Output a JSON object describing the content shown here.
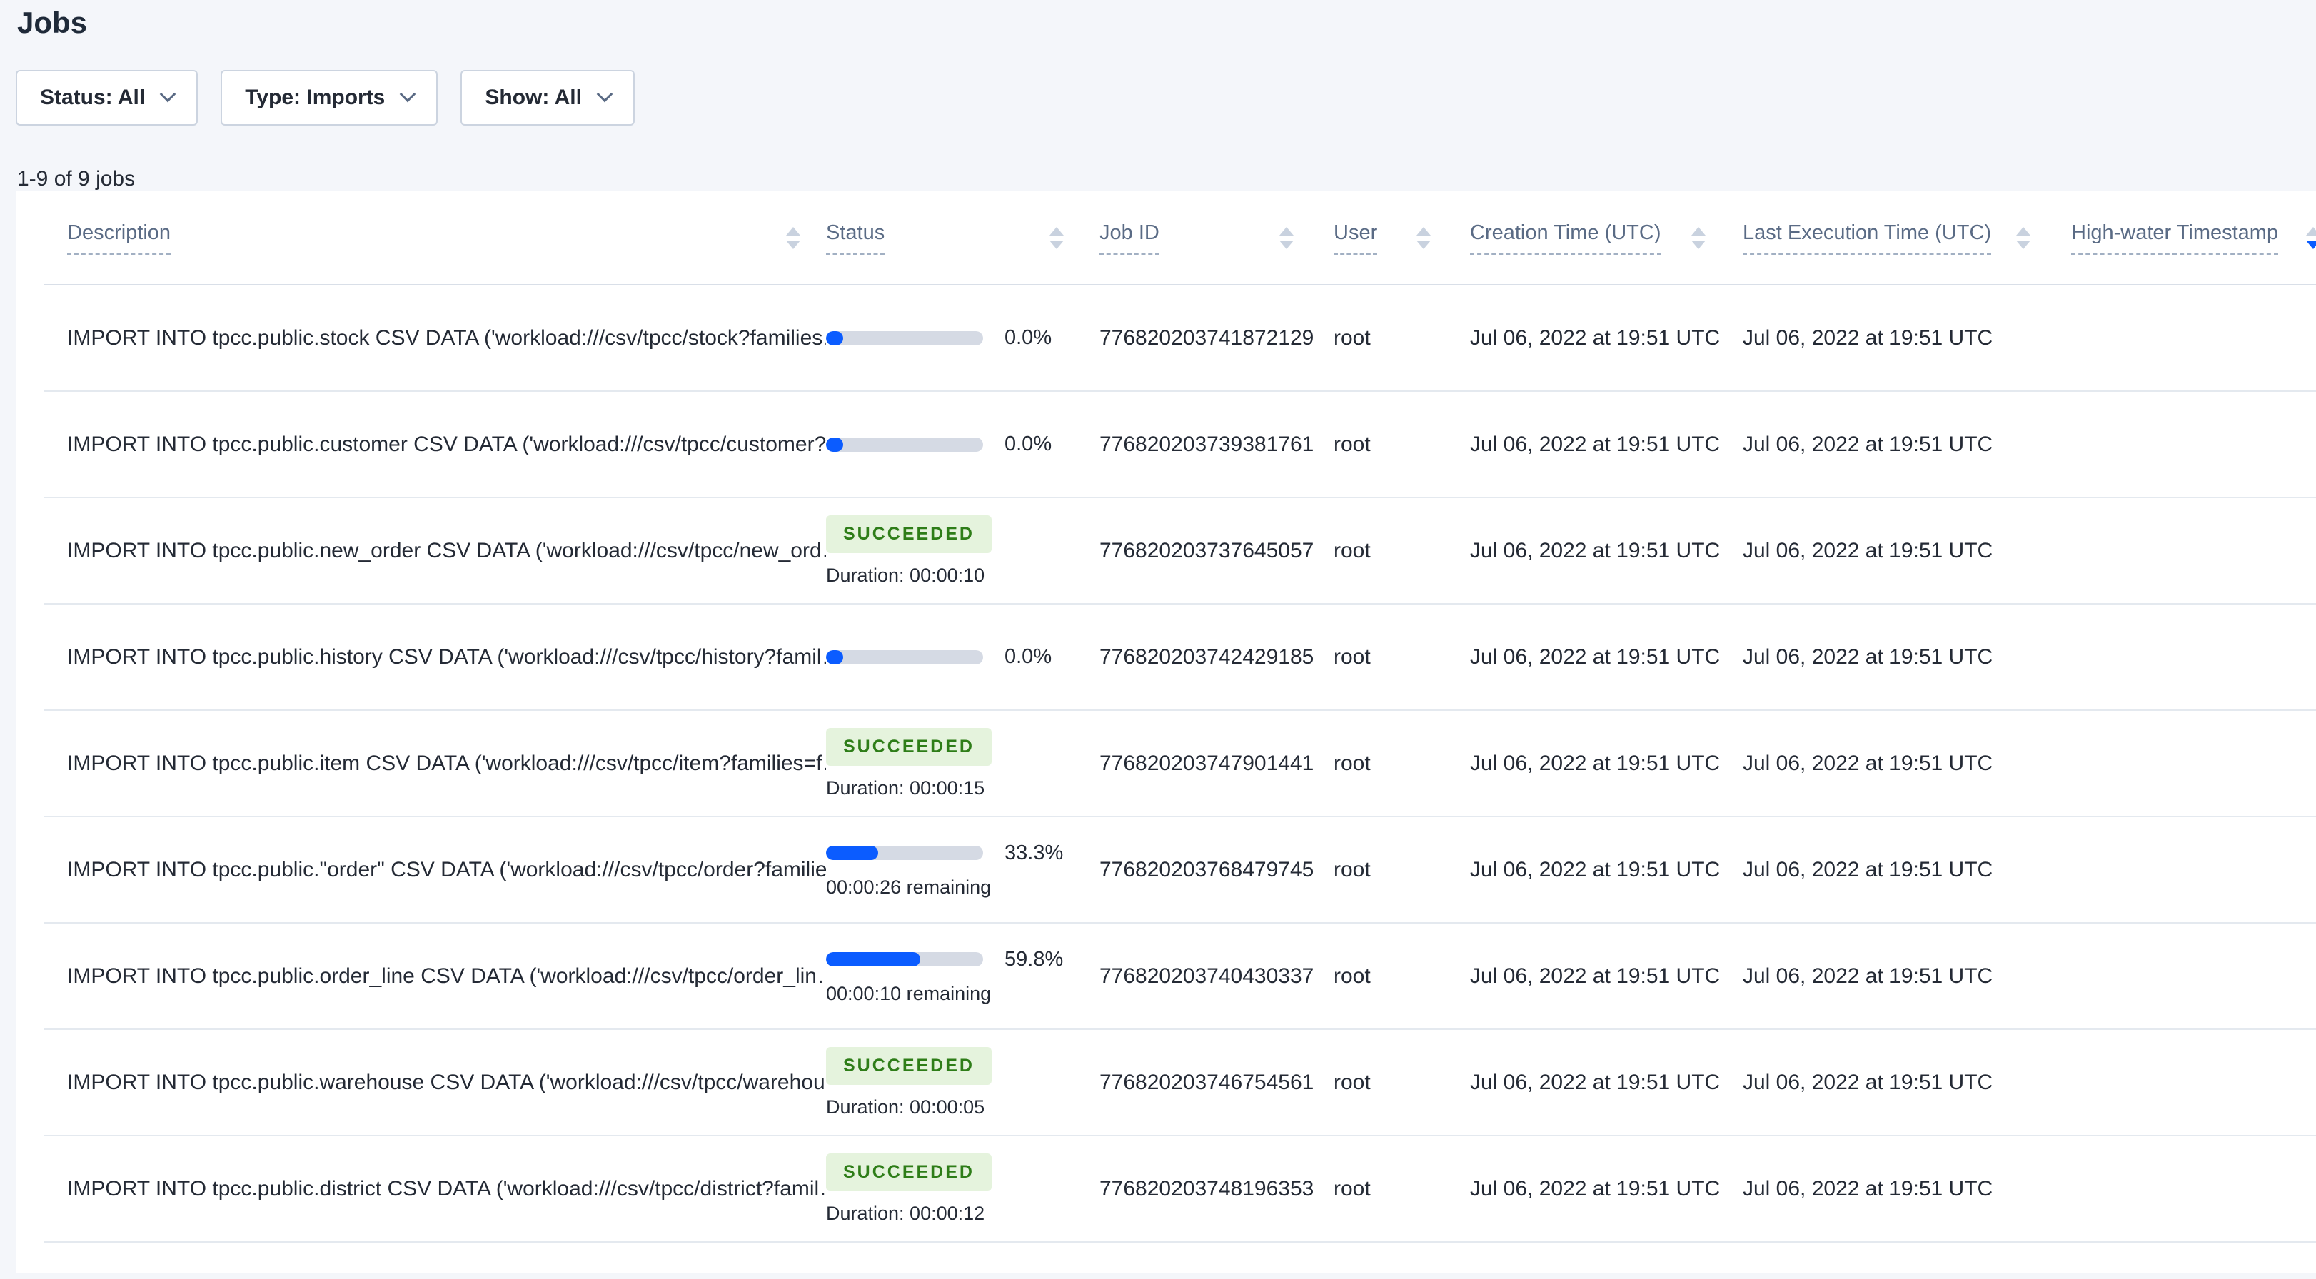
{
  "page": {
    "title": "Jobs",
    "jobs_count": "1-9 of 9 jobs"
  },
  "filters": [
    {
      "label": "Status: All"
    },
    {
      "label": "Type: Imports"
    },
    {
      "label": "Show: All"
    }
  ],
  "colors": {
    "accent_blue": "#0b5cff",
    "progress_track": "#d5dae4",
    "success_text": "#2e7d18",
    "success_bg": "#e5f3dd",
    "page_bg": "#f4f6fa",
    "header_text": "#5a6b85",
    "body_text": "#242a35"
  },
  "table": {
    "columns": [
      {
        "label": "Description",
        "sort": "inactive"
      },
      {
        "label": "Status",
        "sort": "inactive"
      },
      {
        "label": "Job ID",
        "sort": "inactive"
      },
      {
        "label": "User",
        "sort": "inactive"
      },
      {
        "label": "Creation Time (UTC)",
        "sort": "inactive"
      },
      {
        "label": "Last Execution Time (UTC)",
        "sort": "inactive"
      },
      {
        "label": "High-water Timestamp",
        "sort": "desc"
      }
    ],
    "rows": [
      {
        "description": "IMPORT INTO tpcc.public.stock CSV DATA ('workload:///csv/tpcc/stock?families…",
        "status": {
          "kind": "progress",
          "percent": "0.0%",
          "fraction": 0
        },
        "job_id": "776820203741872129",
        "user": "root",
        "creation_time": "Jul 06, 2022 at 19:51 UTC",
        "last_execution_time": "Jul 06, 2022 at 19:51 UTC",
        "high_water": ""
      },
      {
        "description": "IMPORT INTO tpcc.public.customer CSV DATA ('workload:///csv/tpcc/customer?f…",
        "status": {
          "kind": "progress",
          "percent": "0.0%",
          "fraction": 0
        },
        "job_id": "776820203739381761",
        "user": "root",
        "creation_time": "Jul 06, 2022 at 19:51 UTC",
        "last_execution_time": "Jul 06, 2022 at 19:51 UTC",
        "high_water": ""
      },
      {
        "description": "IMPORT INTO tpcc.public.new_order CSV DATA ('workload:///csv/tpcc/new_ord…",
        "status": {
          "kind": "succeeded",
          "label": "SUCCEEDED",
          "duration": "Duration: 00:00:10"
        },
        "job_id": "776820203737645057",
        "user": "root",
        "creation_time": "Jul 06, 2022 at 19:51 UTC",
        "last_execution_time": "Jul 06, 2022 at 19:51 UTC",
        "high_water": ""
      },
      {
        "description": "IMPORT INTO tpcc.public.history CSV DATA ('workload:///csv/tpcc/history?famil…",
        "status": {
          "kind": "progress",
          "percent": "0.0%",
          "fraction": 0
        },
        "job_id": "776820203742429185",
        "user": "root",
        "creation_time": "Jul 06, 2022 at 19:51 UTC",
        "last_execution_time": "Jul 06, 2022 at 19:51 UTC",
        "high_water": ""
      },
      {
        "description": "IMPORT INTO tpcc.public.item CSV DATA ('workload:///csv/tpcc/item?families=f…",
        "status": {
          "kind": "succeeded",
          "label": "SUCCEEDED",
          "duration": "Duration: 00:00:15"
        },
        "job_id": "776820203747901441",
        "user": "root",
        "creation_time": "Jul 06, 2022 at 19:51 UTC",
        "last_execution_time": "Jul 06, 2022 at 19:51 UTC",
        "high_water": ""
      },
      {
        "description": "IMPORT INTO tpcc.public.\"order\" CSV DATA ('workload:///csv/tpcc/order?familie…",
        "status": {
          "kind": "progress",
          "percent": "33.3%",
          "fraction": 0.333,
          "remaining": "00:00:26 remaining"
        },
        "job_id": "776820203768479745",
        "user": "root",
        "creation_time": "Jul 06, 2022 at 19:51 UTC",
        "last_execution_time": "Jul 06, 2022 at 19:51 UTC",
        "high_water": ""
      },
      {
        "description": "IMPORT INTO tpcc.public.order_line CSV DATA ('workload:///csv/tpcc/order_lin…",
        "status": {
          "kind": "progress",
          "percent": "59.8%",
          "fraction": 0.598,
          "remaining": "00:00:10 remaining"
        },
        "job_id": "776820203740430337",
        "user": "root",
        "creation_time": "Jul 06, 2022 at 19:51 UTC",
        "last_execution_time": "Jul 06, 2022 at 19:51 UTC",
        "high_water": ""
      },
      {
        "description": "IMPORT INTO tpcc.public.warehouse CSV DATA ('workload:///csv/tpcc/warehou…",
        "status": {
          "kind": "succeeded",
          "label": "SUCCEEDED",
          "duration": "Duration: 00:00:05"
        },
        "job_id": "776820203746754561",
        "user": "root",
        "creation_time": "Jul 06, 2022 at 19:51 UTC",
        "last_execution_time": "Jul 06, 2022 at 19:51 UTC",
        "high_water": ""
      },
      {
        "description": "IMPORT INTO tpcc.public.district CSV DATA ('workload:///csv/tpcc/district?famil…",
        "status": {
          "kind": "succeeded",
          "label": "SUCCEEDED",
          "duration": "Duration: 00:00:12"
        },
        "job_id": "776820203748196353",
        "user": "root",
        "creation_time": "Jul 06, 2022 at 19:51 UTC",
        "last_execution_time": "Jul 06, 2022 at 19:51 UTC",
        "high_water": ""
      }
    ]
  }
}
